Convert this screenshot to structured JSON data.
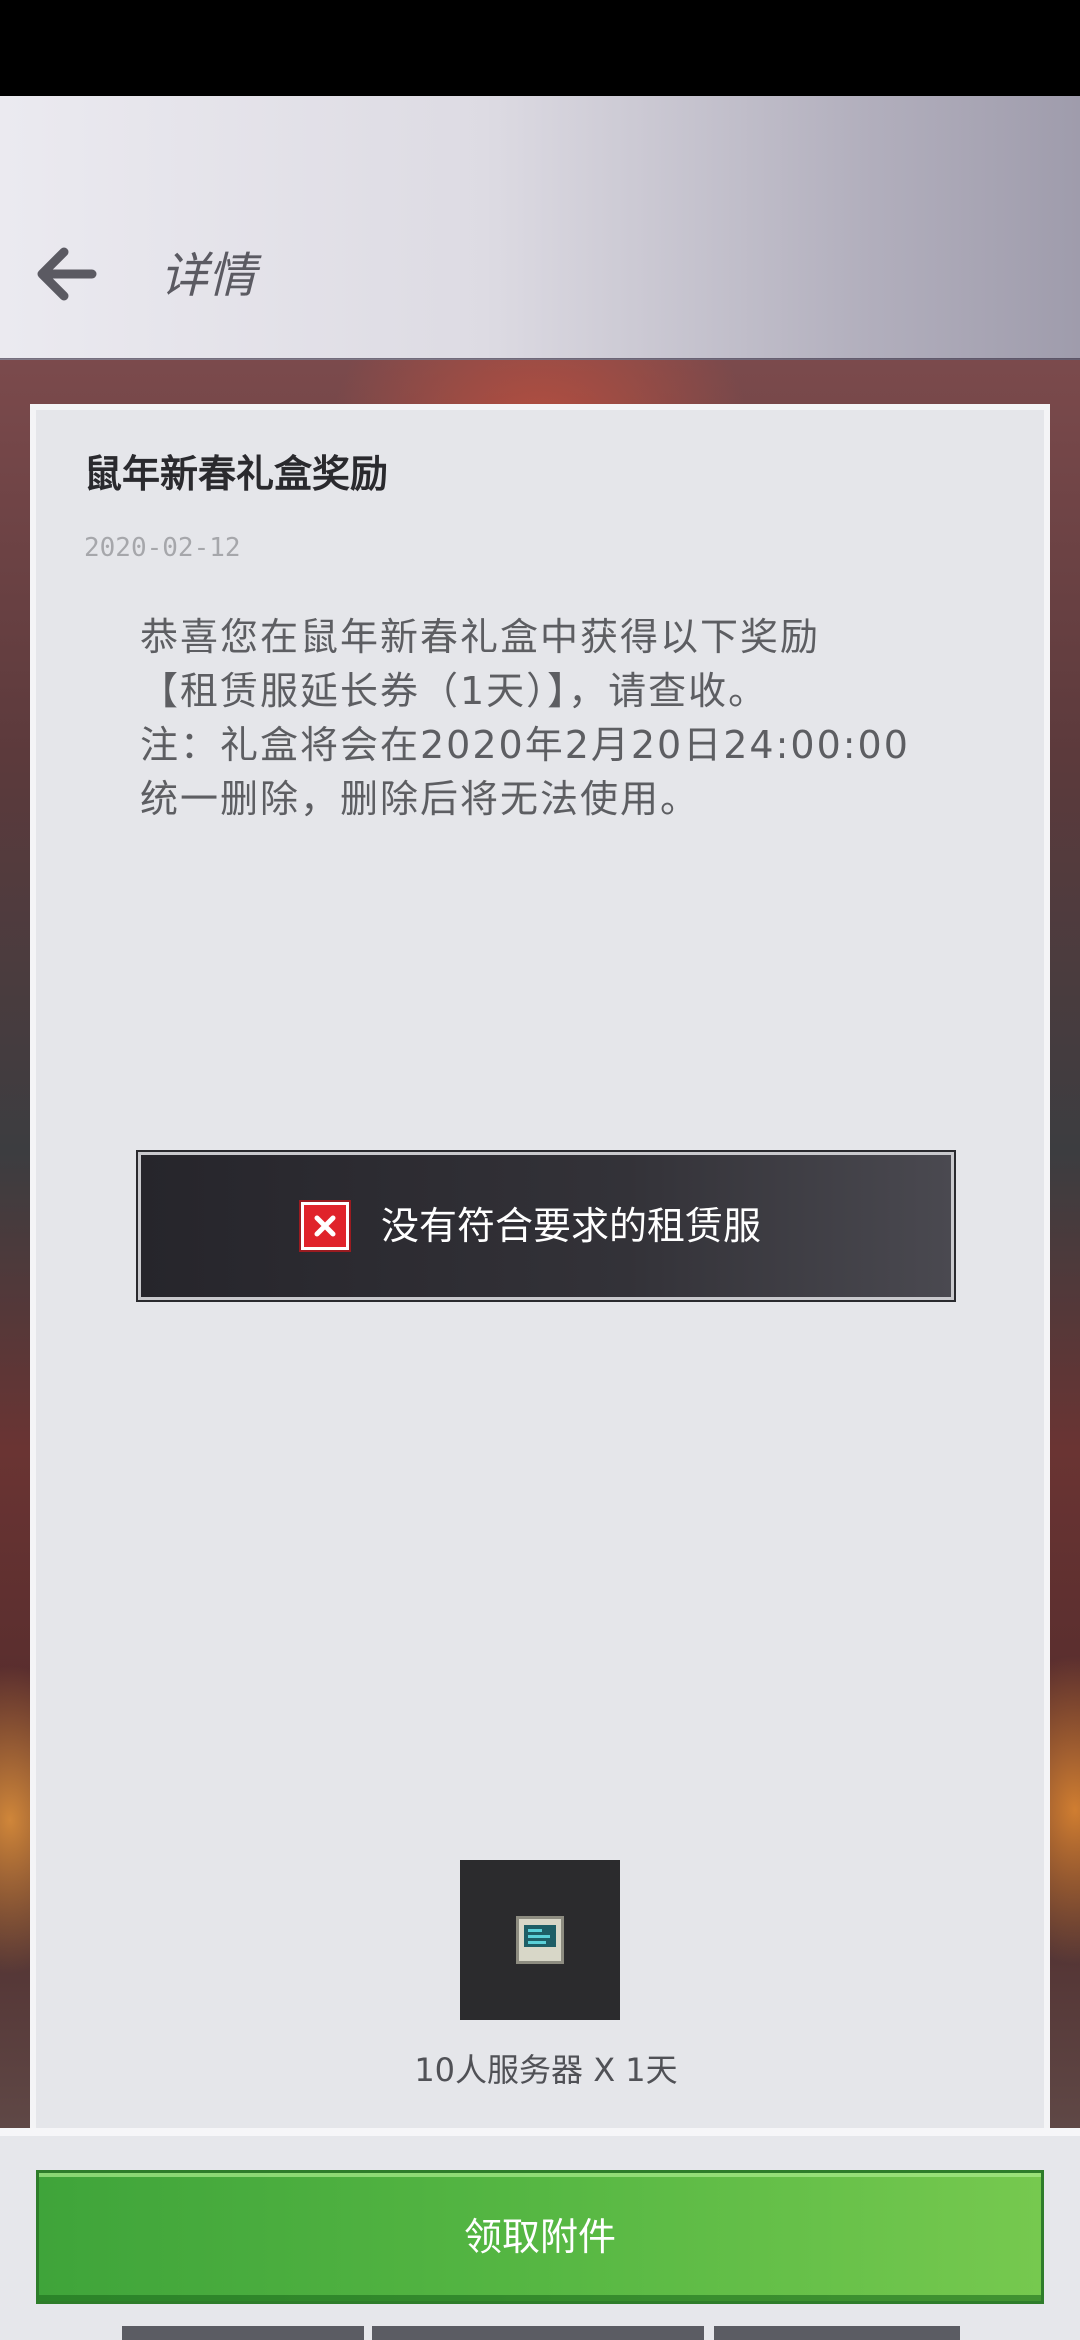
{
  "header": {
    "title": "详情",
    "back_icon": "arrow-left-icon"
  },
  "mail": {
    "title": "鼠年新春礼盒奖励",
    "date": "2020-02-12",
    "body_lines": [
      "恭喜您在鼠年新春礼盒中获得以下奖励",
      "【租赁服延长券（1天）】，请查收。",
      "注：礼盒将会在2020年2月20日24:00:00",
      "统一删除，删除后将无法使用。"
    ]
  },
  "toast": {
    "icon": "error-x-icon",
    "message": "没有符合要求的租赁服"
  },
  "attachment": {
    "icon": "server-icon",
    "label": "10人服务器 X 1天"
  },
  "footer": {
    "claim_label": "领取附件"
  },
  "colors": {
    "card_bg": "#e5e6ea",
    "button_green": "#56b743",
    "toast_bg": "#2c2b31",
    "error_red": "#e0232b"
  }
}
